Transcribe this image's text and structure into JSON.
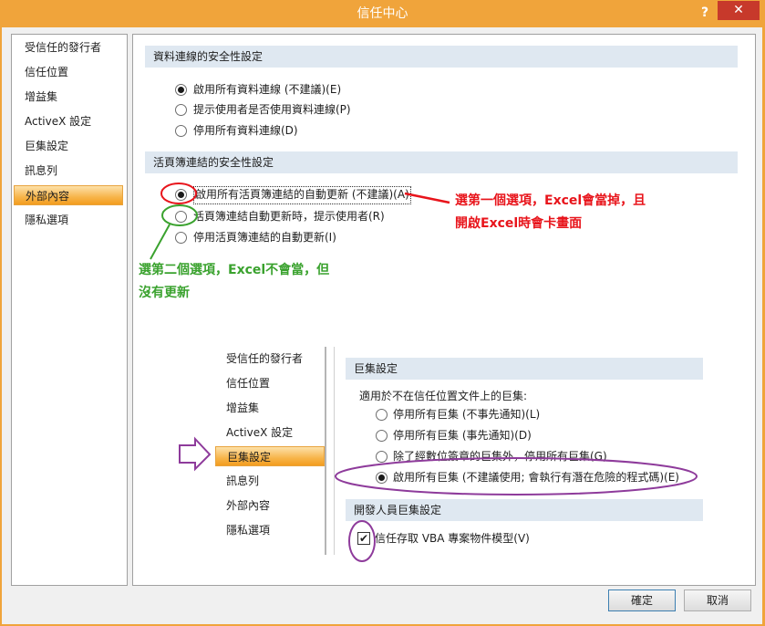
{
  "window": {
    "title": "信任中心",
    "help": "?",
    "close": "✕"
  },
  "nav": {
    "items": [
      {
        "label": "受信任的發行者"
      },
      {
        "label": "信任位置"
      },
      {
        "label": "增益集"
      },
      {
        "label": "ActiveX 設定"
      },
      {
        "label": "巨集設定"
      },
      {
        "label": "訊息列"
      },
      {
        "label": "外部內容"
      },
      {
        "label": "隱私選項"
      }
    ],
    "selected": "外部內容"
  },
  "data_conn": {
    "header": "資料連線的安全性設定",
    "options": [
      {
        "label": "啟用所有資料連線 (不建議)(E)",
        "checked": true
      },
      {
        "label": "提示使用者是否使用資料連線(P)",
        "checked": false
      },
      {
        "label": "停用所有資料連線(D)",
        "checked": false
      }
    ]
  },
  "workbook_links": {
    "header": "活頁簿連結的安全性設定",
    "options": [
      {
        "label": "啟用所有活頁簿連結的自動更新 (不建議)(A)",
        "checked": true
      },
      {
        "label": "活頁簿連結自動更新時，提示使用者(R)",
        "checked": false
      },
      {
        "label": "停用活頁簿連結的自動更新(I)",
        "checked": false
      }
    ]
  },
  "annotations": {
    "red_line1": "選第一個選項，Excel會當掉，且",
    "red_line2": "開啟Excel時會卡畫面",
    "green_line1": "選第二個選項，Excel不會當，但",
    "green_line2": "沒有更新",
    "colors": {
      "red": "#e8141b",
      "green": "#3aa22e",
      "purple": "#8e3b9b"
    }
  },
  "inset": {
    "nav": [
      {
        "label": "受信任的發行者"
      },
      {
        "label": "信任位置"
      },
      {
        "label": "增益集"
      },
      {
        "label": "ActiveX 設定"
      },
      {
        "label": "巨集設定"
      },
      {
        "label": "訊息列"
      },
      {
        "label": "外部內容"
      },
      {
        "label": "隱私選項"
      }
    ],
    "selected": "巨集設定",
    "macro_header": "巨集設定",
    "macro_subtitle": "適用於不在信任位置文件上的巨集:",
    "macro_options": [
      {
        "label": "停用所有巨集 (不事先通知)(L)",
        "checked": false
      },
      {
        "label": "停用所有巨集 (事先通知)(D)",
        "checked": false
      },
      {
        "label": "除了經數位簽章的巨集外，停用所有巨集(G)",
        "checked": false
      },
      {
        "label": "啟用所有巨集 (不建議使用; 會執行有潛在危險的程式碼)(E)",
        "checked": true
      }
    ],
    "dev_header": "開發人員巨集設定",
    "dev_option": {
      "label": "信任存取 VBA 專案物件模型(V)",
      "checked": true
    }
  },
  "buttons": {
    "ok": "確定",
    "cancel": "取消"
  }
}
